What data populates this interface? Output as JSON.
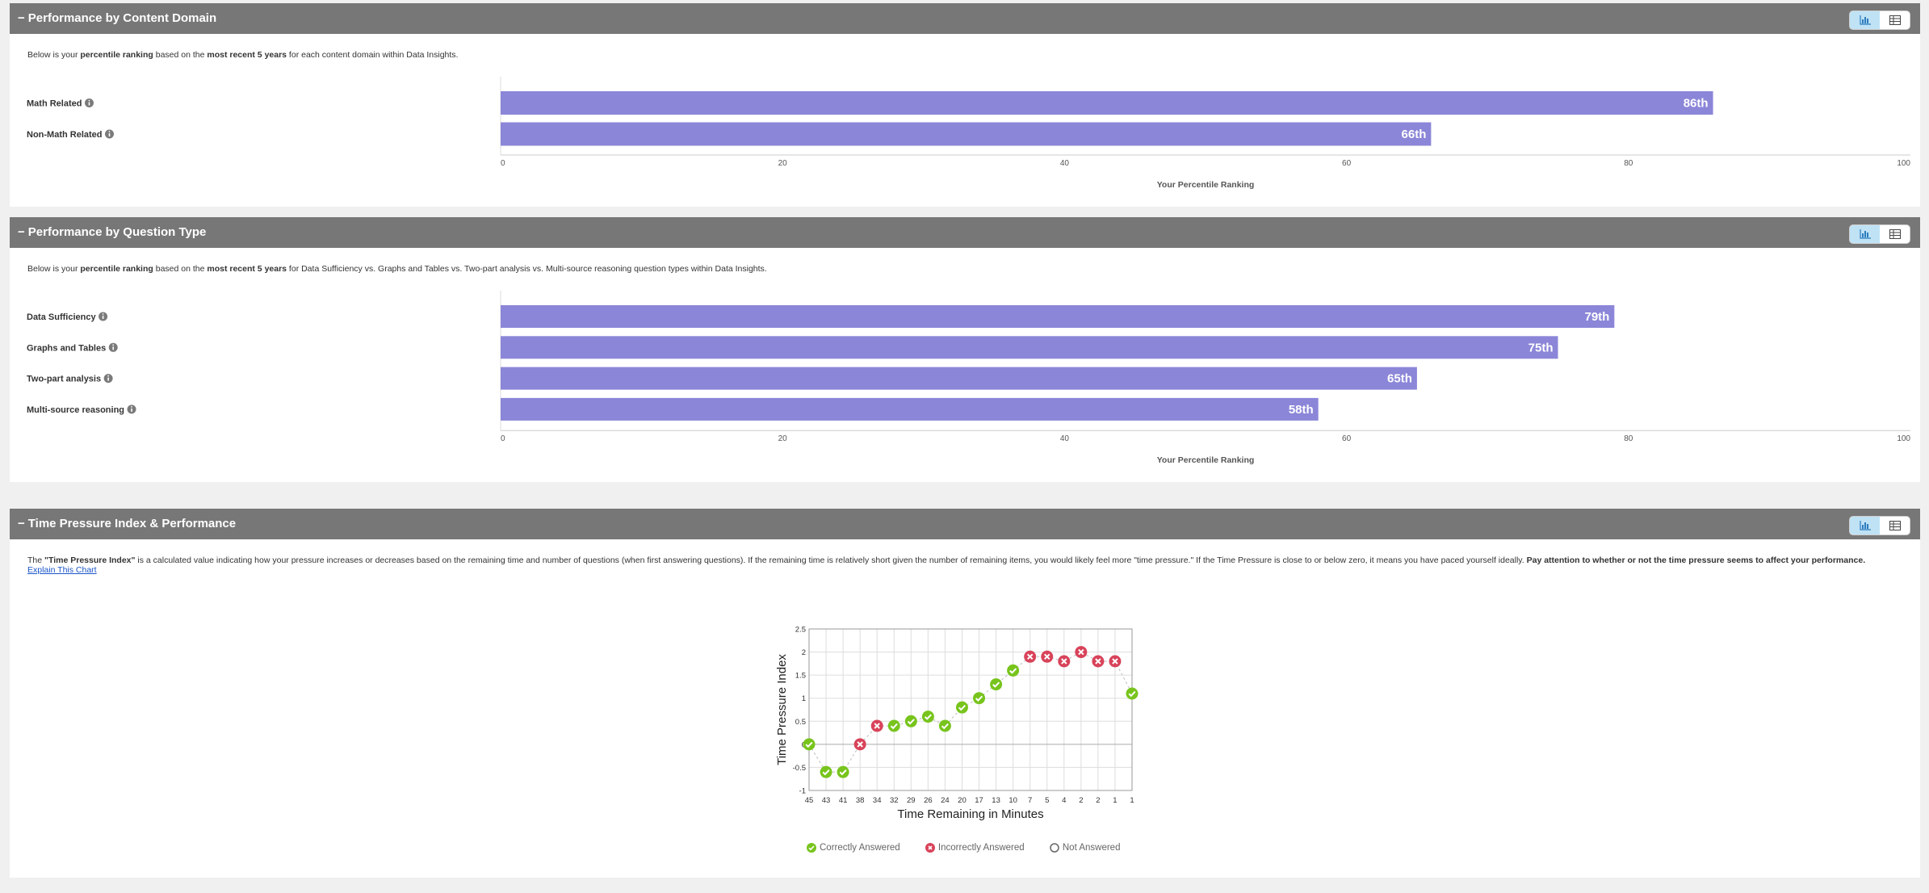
{
  "sections": [
    {
      "title": "Performance by Content Domain",
      "desc_parts": [
        "Below is your ",
        "percentile ranking",
        " based on the ",
        "most recent 5 years",
        " for each content domain within Data Insights."
      ]
    },
    {
      "title": "Performance by Question Type",
      "desc_parts": [
        "Below is your ",
        "percentile ranking",
        " based on the ",
        "most recent 5 years",
        " for Data Sufficiency vs. Graphs and Tables vs. Two-part analysis vs. Multi-source reasoning question types within Data Insights."
      ]
    },
    {
      "title": "Time Pressure Index & Performance",
      "desc_parts": [
        "The ",
        "\"Time Pressure Index\"",
        " is a calculated value indicating how your pressure increases or decreases based on the remaining time and number of questions (when first answering questions). If the remaining time is relatively short given the number of remaining items, you would likely feel more \"time pressure.\" If the Time Pressure is close to or below zero, it means you have paced yourself ideally. ",
        "Pay attention to whether or not the time pressure seems to affect your performance."
      ],
      "link": "Explain This Chart"
    }
  ],
  "legend": [
    "Correctly Answered",
    "Incorrectly Answered",
    "Not Answered"
  ],
  "colors": {
    "bar": "#8b86d8",
    "correct": "#78c41d",
    "incorrect": "#d8435a",
    "header": "#777777"
  },
  "chart_data": [
    {
      "type": "bar",
      "orientation": "horizontal",
      "categories": [
        "Math Related",
        "Non-Math Related"
      ],
      "values": [
        86,
        66
      ],
      "value_labels": [
        "86th",
        "66th"
      ],
      "xlabel": "Your Percentile Ranking",
      "xlim": [
        0,
        100
      ],
      "xticks": [
        0,
        20,
        40,
        60,
        80,
        100
      ]
    },
    {
      "type": "bar",
      "orientation": "horizontal",
      "categories": [
        "Data Sufficiency",
        "Graphs and Tables",
        "Two-part analysis",
        "Multi-source reasoning"
      ],
      "values": [
        79,
        75,
        65,
        58
      ],
      "value_labels": [
        "79th",
        "75th",
        "65th",
        "58th"
      ],
      "xlabel": "Your Percentile Ranking",
      "xlim": [
        0,
        100
      ],
      "xticks": [
        0,
        20,
        40,
        60,
        80,
        100
      ]
    },
    {
      "type": "line",
      "xlabel": "Time Remaining in Minutes",
      "ylabel": "Time Pressure Index",
      "ylim": [
        -1,
        2.5
      ],
      "yticks": [
        "2.5",
        "2",
        "1.5",
        "1",
        "0.5",
        "0",
        "-0.5",
        "-1"
      ],
      "x": [
        "45",
        "43",
        "41",
        "38",
        "34",
        "32",
        "29",
        "26",
        "24",
        "20",
        "17",
        "13",
        "10",
        "7",
        "5",
        "4",
        "2",
        "2",
        "1",
        "1"
      ],
      "y": [
        0,
        -0.6,
        -0.6,
        0,
        0.4,
        0.4,
        0.5,
        0.6,
        0.4,
        0.8,
        1.0,
        1.3,
        1.6,
        1.9,
        1.9,
        1.8,
        2.0,
        1.8,
        1.8,
        1.1
      ],
      "status": [
        "correct",
        "correct",
        "correct",
        "incorrect",
        "incorrect",
        "correct",
        "correct",
        "correct",
        "correct",
        "correct",
        "correct",
        "correct",
        "correct",
        "incorrect",
        "incorrect",
        "incorrect",
        "incorrect",
        "incorrect",
        "incorrect",
        "correct"
      ],
      "grid": true
    }
  ]
}
